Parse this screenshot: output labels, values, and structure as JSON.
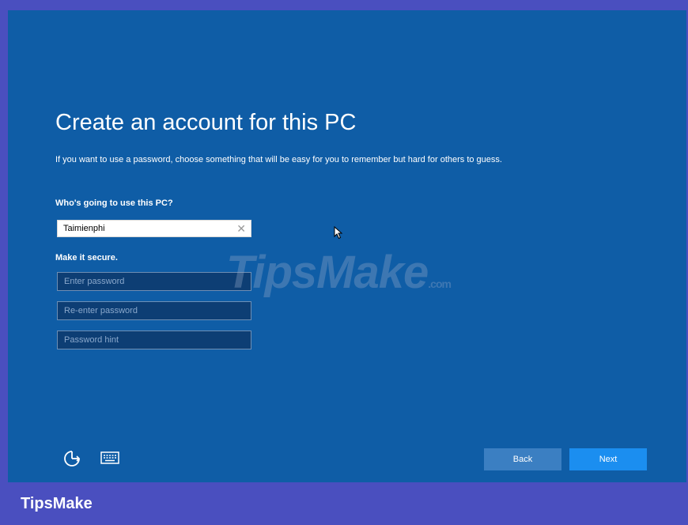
{
  "page": {
    "title": "Create an account for this PC",
    "description": "If you want to use a password, choose something that will be easy for you to remember but hard for others to guess."
  },
  "form": {
    "user_label": "Who's going to use this PC?",
    "user_value": "Taimienphi",
    "secure_label": "Make it secure.",
    "password_placeholder": "Enter password",
    "reenter_placeholder": "Re-enter password",
    "hint_placeholder": "Password hint"
  },
  "footer": {
    "back_label": "Back",
    "next_label": "Next"
  },
  "watermark": {
    "text": "TipsMake",
    "domain": ".com"
  },
  "brand": {
    "label": "TipsMake"
  },
  "icons": [
    "ease-of-access-icon",
    "keyboard-icon",
    "clear-icon",
    "mouse-cursor-icon"
  ],
  "colors": {
    "oobe_background": "#0f5da6",
    "frame": "#4a4fbf",
    "next_button": "#1b8ef0",
    "back_button": "#3b7fc2",
    "password_field": "#0d3e74"
  }
}
